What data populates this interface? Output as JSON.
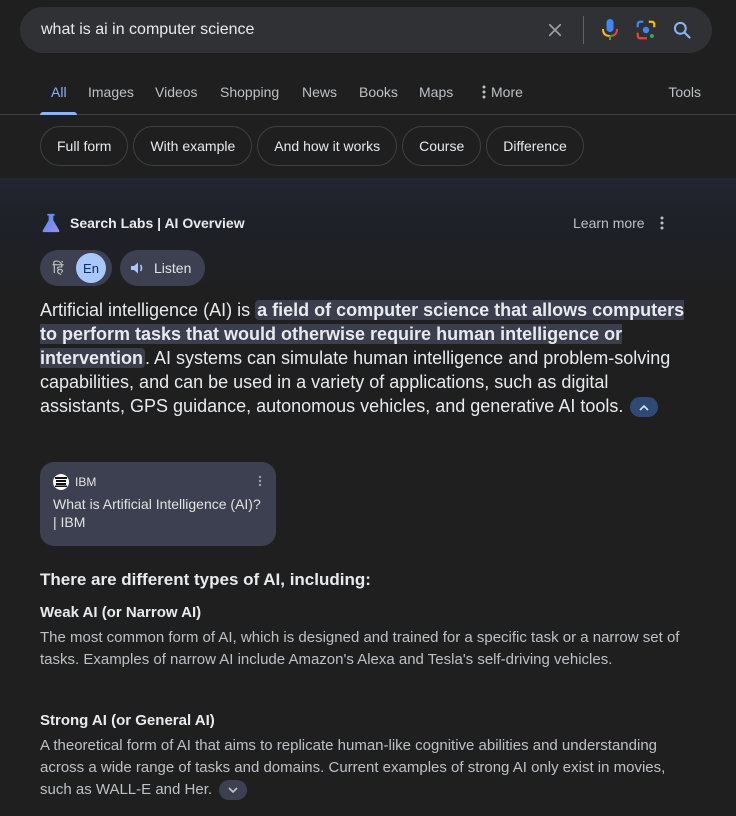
{
  "search": {
    "query": "what is ai in computer science",
    "icons": [
      "close-icon",
      "microphone-icon",
      "google-lens-icon",
      "search-icon"
    ]
  },
  "tabs": [
    {
      "label": "All",
      "active": true
    },
    {
      "label": "Images"
    },
    {
      "label": "Videos"
    },
    {
      "label": "Shopping"
    },
    {
      "label": "News"
    },
    {
      "label": "Books"
    },
    {
      "label": "Maps"
    },
    {
      "label": "More"
    }
  ],
  "tools_label": "Tools",
  "chips": [
    "Full form",
    "With example",
    "And how it works",
    "Course",
    "Difference"
  ],
  "ai_overview": {
    "title": "Search Labs | AI Overview",
    "learn_more": "Learn more",
    "lang_hi": "हिं",
    "lang_en": "En",
    "listen": "Listen",
    "para_pre": "Artificial intelligence (AI) is ",
    "para_highlight": "a field of computer science that allows computers to perform tasks that would otherwise require human intelligence or intervention",
    "para_post": ". AI systems can simulate human intelligence and problem-solving capabilities, and can be used in a variety of applications, such as digital assistants, GPS guidance, autonomous vehicles, and generative AI tools.",
    "source": {
      "site": "IBM",
      "title": "What is Artificial Intelligence (AI)? | IBM"
    },
    "types_heading": "There are different types of AI, including:",
    "types": [
      {
        "title": "Weak AI (or Narrow AI)",
        "desc": "The most common form of AI, which is designed and trained for a specific task or a narrow set of tasks. Examples of narrow AI include Amazon's Alexa and Tesla's self-driving vehicles."
      },
      {
        "title": "Strong AI (or General AI)",
        "desc": "A theoretical form of AI that aims to replicate human-like cognitive abilities and understanding across a wide range of tasks and domains. Current examples of strong AI only exist in movies, such as WALL-E and Her."
      }
    ]
  },
  "colors": {
    "background": "#1f1f1f",
    "search_bar": "#303134",
    "accent": "#8ab4f8",
    "highlight": "#3a3e4d"
  }
}
